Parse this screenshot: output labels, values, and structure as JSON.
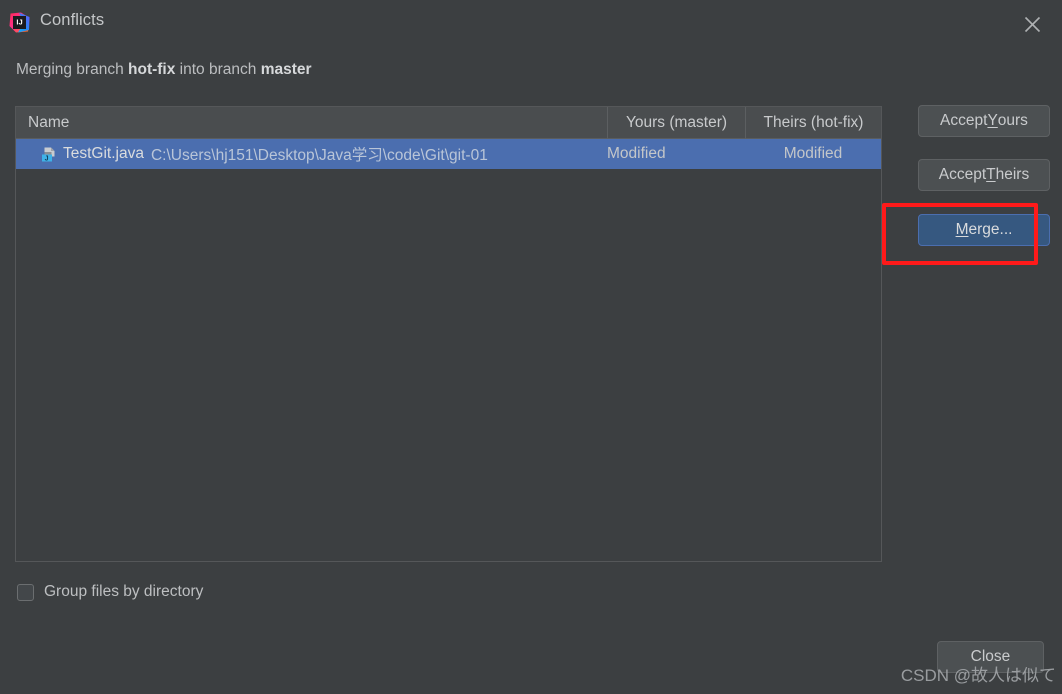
{
  "window": {
    "title": "Conflicts",
    "app_icon": "intellij-idea-icon",
    "close_icon": "close-icon"
  },
  "subtitle": {
    "prefix": "Merging branch ",
    "source_branch": "hot-fix",
    "middle": " into branch ",
    "target_branch": "master"
  },
  "table": {
    "columns": [
      {
        "key": "name",
        "label": "Name"
      },
      {
        "key": "yours",
        "label": "Yours (master)"
      },
      {
        "key": "theirs",
        "label": "Theirs (hot-fix)"
      }
    ],
    "rows": [
      {
        "icon": "java-file-icon",
        "file_name": "TestGit.java",
        "file_path": "C:\\Users\\hj151\\Desktop\\Java学习\\code\\Git\\git-01",
        "yours": "Modified",
        "theirs": "Modified",
        "selected": true
      }
    ]
  },
  "actions": {
    "accept_yours": {
      "prefix": "Accept ",
      "mnemonic": "Y",
      "suffix": "ours"
    },
    "accept_theirs": {
      "prefix": "Accept ",
      "mnemonic": "T",
      "suffix": "heirs"
    },
    "merge": {
      "prefix": "",
      "mnemonic": "M",
      "suffix": "erge..."
    }
  },
  "options": {
    "group_files_by_directory": {
      "label": "Group files by directory",
      "checked": false
    }
  },
  "footer": {
    "close_label": "Close"
  },
  "annotation": {
    "target": "merge-button",
    "color": "#FF1A1A"
  },
  "watermark": {
    "text": "CSDN @故人は似て"
  }
}
